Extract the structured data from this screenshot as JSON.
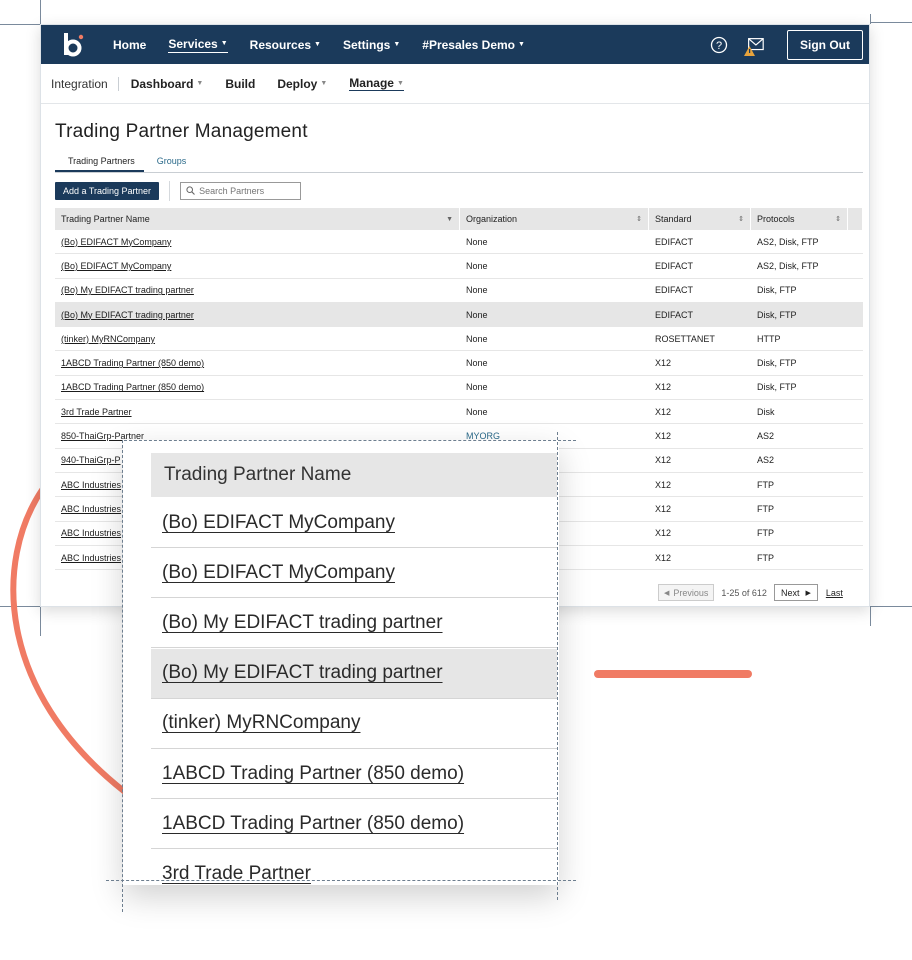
{
  "topnav": {
    "items": [
      {
        "label": "Home",
        "caret": false,
        "active": false
      },
      {
        "label": "Services",
        "caret": true,
        "active": true
      },
      {
        "label": "Resources",
        "caret": true,
        "active": false
      },
      {
        "label": "Settings",
        "caret": true,
        "active": false
      },
      {
        "label": "#Presales Demo",
        "caret": true,
        "active": false
      }
    ],
    "signout": "Sign Out",
    "icons": [
      "help-icon",
      "mail-icon",
      "warning-icon"
    ],
    "colors": {
      "bar": "#1b3a5b",
      "accent": "#f07b64"
    }
  },
  "subnav": {
    "integration": "Integration",
    "items": [
      {
        "label": "Dashboard",
        "caret": true
      },
      {
        "label": "Build",
        "caret": false
      },
      {
        "label": "Deploy",
        "caret": true
      },
      {
        "label": "Manage",
        "caret": true
      }
    ]
  },
  "page": {
    "title": "Trading Partner Management",
    "tabs": [
      "Trading Partners",
      "Groups"
    ],
    "add_button": "Add a Trading Partner",
    "search_placeholder": "Search Partners"
  },
  "table": {
    "headers": [
      "Trading Partner Name",
      "Organization",
      "Standard",
      "Protocols"
    ],
    "rows": [
      [
        "(Bo) EDIFACT MyCompany",
        "None",
        "EDIFACT",
        "AS2, Disk, FTP"
      ],
      [
        "(Bo) EDIFACT MyCompany",
        "None",
        "EDIFACT",
        "AS2, Disk, FTP"
      ],
      [
        "(Bo) My EDIFACT trading partner",
        "None",
        "EDIFACT",
        "Disk, FTP"
      ],
      [
        "(Bo) My EDIFACT trading partner",
        "None",
        "EDIFACT",
        "Disk, FTP"
      ],
      [
        "(tinker) MyRNCompany",
        "None",
        "ROSETTANET",
        "HTTP"
      ],
      [
        "1ABCD Trading Partner (850 demo)",
        "None",
        "X12",
        "Disk, FTP"
      ],
      [
        "1ABCD Trading Partner (850 demo)",
        "None",
        "X12",
        "Disk, FTP"
      ],
      [
        "3rd Trade Partner",
        "None",
        "X12",
        "Disk"
      ],
      [
        "850-ThaiGrp-Partner",
        "MYORG",
        "X12",
        "AS2"
      ],
      [
        "940-ThaiGrp-P",
        "",
        "X12",
        "AS2"
      ],
      [
        "ABC Industries",
        "",
        "X12",
        "FTP"
      ],
      [
        "ABC Industries",
        "",
        "X12",
        "FTP"
      ],
      [
        "ABC Industries",
        "",
        "X12",
        "FTP"
      ],
      [
        "ABC Industries",
        "",
        "X12",
        "FTP"
      ]
    ],
    "highlighted_row": 3
  },
  "pager": {
    "previous": "Previous",
    "count": "1-25 of 612",
    "next": "Next",
    "last": "Last"
  },
  "zoom": {
    "header": "Trading Partner Name",
    "rows": [
      "(Bo) EDIFACT MyCompany",
      "(Bo) EDIFACT MyCompany",
      "(Bo) My EDIFACT trading partner",
      "(Bo) My EDIFACT trading partner",
      "(tinker) MyRNCompany",
      "1ABCD Trading Partner (850 demo)",
      "1ABCD Trading Partner (850 demo)",
      "3rd Trade Partner"
    ],
    "highlighted_row": 3
  }
}
